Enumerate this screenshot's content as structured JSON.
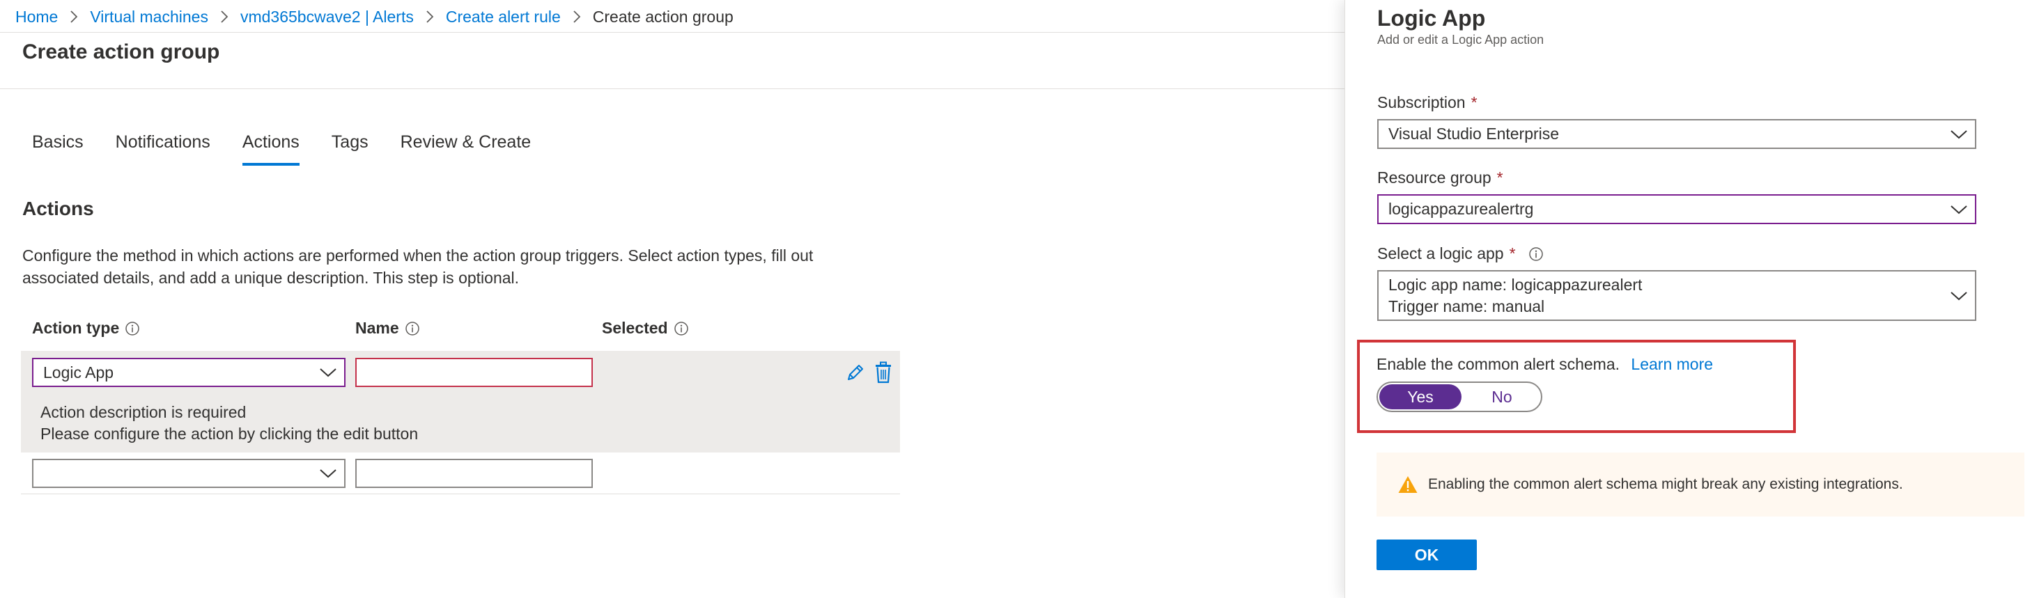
{
  "breadcrumb": {
    "items": [
      "Home",
      "Virtual machines",
      "vmd365bcwave2 | Alerts",
      "Create alert rule"
    ],
    "current": "Create action group"
  },
  "page": {
    "title": "Create action group"
  },
  "tabs": [
    {
      "label": "Basics",
      "active": false
    },
    {
      "label": "Notifications",
      "active": false
    },
    {
      "label": "Actions",
      "active": true
    },
    {
      "label": "Tags",
      "active": false
    },
    {
      "label": "Review & Create",
      "active": false
    }
  ],
  "actions": {
    "title": "Actions",
    "description_line1": "Configure the method in which actions are performed when the action group triggers. Select action types, fill out",
    "description_line2": "associated details, and add a unique description. This step is optional.",
    "columns": {
      "action_type": "Action type",
      "name": "Name",
      "selected": "Selected"
    },
    "rows": [
      {
        "action_type": "Logic App",
        "name": "",
        "message_line1": "Action description is required",
        "message_line2": "Please configure the action by clicking the edit button"
      },
      {
        "action_type": "",
        "name": ""
      }
    ]
  },
  "panel": {
    "title": "Logic App",
    "subtitle": "Add or edit a Logic App action",
    "subscription": {
      "label": "Subscription",
      "required": "*",
      "value": "Visual Studio Enterprise"
    },
    "resource_group": {
      "label": "Resource group",
      "required": "*",
      "value": "logicappazurealertrg"
    },
    "logic_app": {
      "label": "Select a logic app",
      "required": "*",
      "line1": "Logic app name: logicappazurealert",
      "line2": "Trigger name: manual"
    },
    "schema": {
      "label": "Enable the common alert schema.",
      "learn_more": "Learn more",
      "yes": "Yes",
      "no": "No",
      "selected": "Yes"
    },
    "warning": "Enabling the common alert schema might break any existing integrations.",
    "ok_label": "OK"
  },
  "colors": {
    "accent": "#0078d4",
    "toggle_on": "#5c2d91",
    "highlight_border": "#d13438",
    "error_border": "#c4314b",
    "warning_icon": "#f7a30c"
  }
}
